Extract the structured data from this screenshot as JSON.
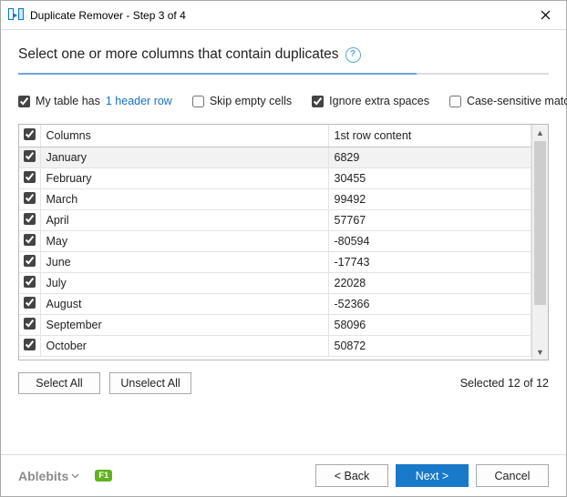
{
  "window": {
    "title": "Duplicate Remover - Step 3 of 4"
  },
  "heading": "Select one or more columns that contain duplicates",
  "options": {
    "header_rows_prefix": "My table has",
    "header_rows_count": "1 header row",
    "skip_empty": "Skip empty cells",
    "ignore_spaces": "Ignore extra spaces",
    "case_sensitive": "Case-sensitive match"
  },
  "table": {
    "col1": "Columns",
    "col2": "1st row content",
    "rows": [
      {
        "name": "January",
        "value": "6829",
        "selected": true
      },
      {
        "name": "February",
        "value": "30455"
      },
      {
        "name": "March",
        "value": "99492"
      },
      {
        "name": "April",
        "value": "57767"
      },
      {
        "name": "May",
        "value": "-80594"
      },
      {
        "name": "June",
        "value": "-17743"
      },
      {
        "name": "July",
        "value": "22028"
      },
      {
        "name": "August",
        "value": "-52366"
      },
      {
        "name": "September",
        "value": "58096"
      },
      {
        "name": "October",
        "value": "50872"
      }
    ]
  },
  "buttons": {
    "select_all": "Select All",
    "unselect_all": "Unselect All",
    "back": "< Back",
    "next": "Next >",
    "cancel": "Cancel"
  },
  "selected_text": "Selected 12 of 12",
  "brand": "Ablebits",
  "f1": "F1"
}
